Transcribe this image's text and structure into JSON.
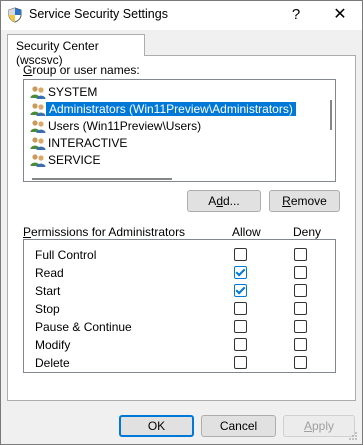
{
  "window": {
    "title": "Service Security Settings",
    "help_glyph": "?",
    "close_glyph": "✕"
  },
  "tab": {
    "label": "Security Center (wscsvc)"
  },
  "group": {
    "label_prefix": "",
    "label_accel": "G",
    "label_rest": "roup or user names:",
    "items": [
      {
        "label": "SYSTEM",
        "selected": false
      },
      {
        "label": "Administrators (Win11Preview\\Administrators)",
        "selected": true
      },
      {
        "label": "Users (Win11Preview\\Users)",
        "selected": false
      },
      {
        "label": "INTERACTIVE",
        "selected": false
      },
      {
        "label": "SERVICE",
        "selected": false
      }
    ]
  },
  "buttons": {
    "add_pre": "A",
    "add_accel": "d",
    "add_post": "d...",
    "remove_accel": "R",
    "remove_post": "emove",
    "ok": "OK",
    "cancel": "Cancel",
    "apply_accel": "A",
    "apply_post": "pply"
  },
  "permissions": {
    "header_accel": "P",
    "header_rest": "ermissions for Administrators",
    "allow_label": "Allow",
    "deny_label": "Deny",
    "rows": [
      {
        "label": "Full Control",
        "allow": false,
        "deny": false
      },
      {
        "label": "Read",
        "allow": true,
        "deny": false
      },
      {
        "label": "Start",
        "allow": true,
        "deny": false
      },
      {
        "label": "Stop",
        "allow": false,
        "deny": false
      },
      {
        "label": "Pause & Continue",
        "allow": false,
        "deny": false
      },
      {
        "label": "Modify",
        "allow": false,
        "deny": false
      },
      {
        "label": "Delete",
        "allow": false,
        "deny": false
      }
    ]
  },
  "colors": {
    "selection": "#0078d7",
    "window_bg": "#f0f0f0"
  },
  "icons": {
    "title": "shield-icon",
    "user": "users-group-icon"
  }
}
